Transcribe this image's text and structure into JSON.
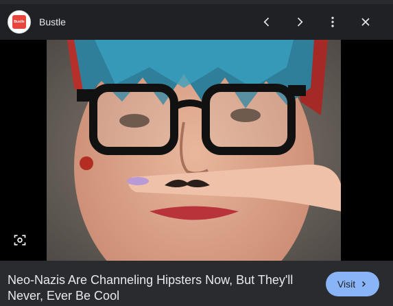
{
  "header": {
    "source_name": "Bustle",
    "logo_text": "Bustle"
  },
  "icons": {
    "prev": "chevron-left-icon",
    "next": "chevron-right-icon",
    "more": "more-vert-icon",
    "close": "close-icon",
    "lens": "lens-search-icon"
  },
  "image": {
    "subject": "woman with blue-dyed bangs, black glasses, finger mustache"
  },
  "caption": {
    "title": "Neo-Nazis Are Channeling Hipsters Now, But They'll Never, Ever Be Cool",
    "visit_label": "Visit"
  },
  "colors": {
    "background": "#202124",
    "caption_bar": "#2a2b2e",
    "visit_button": "#8ab4f8",
    "logo": "#e8453c"
  }
}
